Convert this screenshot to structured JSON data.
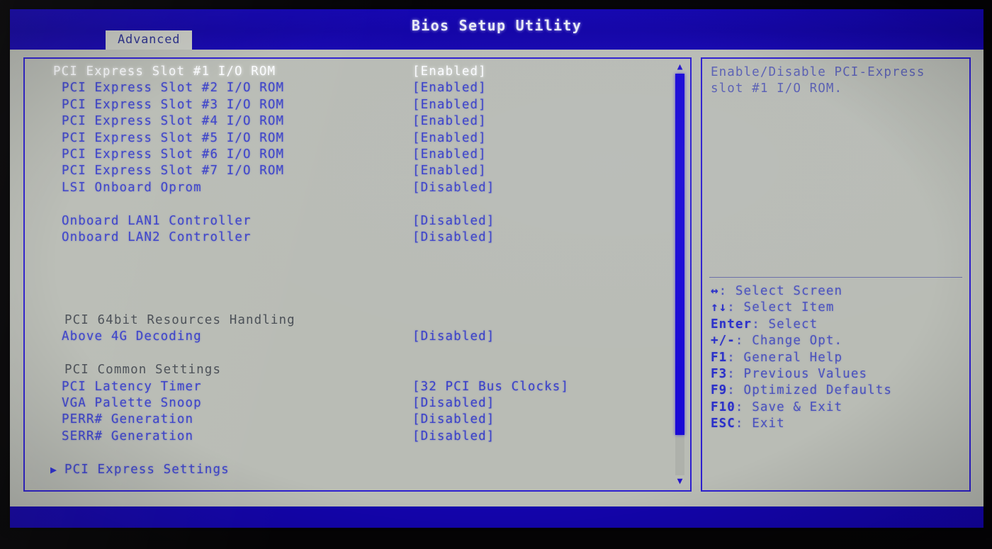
{
  "window": {
    "title": "Bios Setup Utility"
  },
  "tabs": [
    {
      "label": "Advanced",
      "active": true
    }
  ],
  "colors": {
    "header_blue": "#1203a6",
    "panel_gray": "#b9bcb5",
    "item_blue": "#3b41c9",
    "selected_white": "#fbfcff",
    "heading_gray": "#4a4f56",
    "border_blue": "#2d1fd0",
    "scrollbar_thumb": "#1a09d6"
  },
  "settings": [
    {
      "label": "PCI Express Slot #1 I/O ROM",
      "value": "[Enabled]",
      "type": "option",
      "selected": true
    },
    {
      "label": "PCI Express Slot #2 I/O ROM",
      "value": "[Enabled]",
      "type": "option",
      "selected": false
    },
    {
      "label": "PCI Express Slot #3 I/O ROM",
      "value": "[Enabled]",
      "type": "option",
      "selected": false
    },
    {
      "label": "PCI Express Slot #4 I/O ROM",
      "value": "[Enabled]",
      "type": "option",
      "selected": false
    },
    {
      "label": "PCI Express Slot #5 I/O ROM",
      "value": "[Enabled]",
      "type": "option",
      "selected": false
    },
    {
      "label": "PCI Express Slot #6 I/O ROM",
      "value": "[Enabled]",
      "type": "option",
      "selected": false
    },
    {
      "label": "PCI Express Slot #7 I/O ROM",
      "value": "[Enabled]",
      "type": "option",
      "selected": false
    },
    {
      "label": "LSI Onboard Oprom",
      "value": "[Disabled]",
      "type": "option",
      "selected": false
    },
    {
      "label": "",
      "value": "",
      "type": "spacer",
      "selected": false
    },
    {
      "label": "Onboard LAN1 Controller",
      "value": "[Disabled]",
      "type": "option",
      "selected": false
    },
    {
      "label": "Onboard LAN2 Controller",
      "value": "[Disabled]",
      "type": "option",
      "selected": false
    },
    {
      "label": "",
      "value": "",
      "type": "spacer",
      "selected": false
    },
    {
      "label": "",
      "value": "",
      "type": "spacer",
      "selected": false
    },
    {
      "label": "",
      "value": "",
      "type": "spacer",
      "selected": false
    },
    {
      "label": "",
      "value": "",
      "type": "spacer",
      "selected": false
    },
    {
      "label": "PCI 64bit Resources Handling",
      "value": "",
      "type": "heading",
      "selected": false
    },
    {
      "label": "Above 4G Decoding",
      "value": "[Disabled]",
      "type": "option",
      "selected": false
    },
    {
      "label": "",
      "value": "",
      "type": "spacer",
      "selected": false
    },
    {
      "label": "PCI Common Settings",
      "value": "",
      "type": "heading",
      "selected": false
    },
    {
      "label": "PCI Latency Timer",
      "value": "[32 PCI Bus Clocks]",
      "type": "option",
      "selected": false
    },
    {
      "label": "VGA Palette Snoop",
      "value": "[Disabled]",
      "type": "option",
      "selected": false
    },
    {
      "label": "PERR# Generation",
      "value": "[Disabled]",
      "type": "option",
      "selected": false
    },
    {
      "label": "SERR# Generation",
      "value": "[Disabled]",
      "type": "option",
      "selected": false
    },
    {
      "label": "",
      "value": "",
      "type": "spacer",
      "selected": false
    },
    {
      "label": "PCI Express Settings",
      "value": "",
      "type": "submenu",
      "selected": false
    }
  ],
  "scrollbar": {
    "up_glyph": "▲",
    "down_glyph": "▼",
    "thumb_percent": 90
  },
  "help": {
    "text": "Enable/Disable PCI-Express slot #1 I/O ROM."
  },
  "key_legend": [
    {
      "key": "↔",
      "label": ": Select Screen"
    },
    {
      "key": "↑↓",
      "label": ": Select Item"
    },
    {
      "key": "Enter",
      "label": ": Select"
    },
    {
      "key": "+/-",
      "label": ": Change Opt."
    },
    {
      "key": "F1",
      "label": ": General Help"
    },
    {
      "key": "F3",
      "label": ": Previous Values"
    },
    {
      "key": "F9",
      "label": ": Optimized Defaults"
    },
    {
      "key": "F10",
      "label": ": Save & Exit"
    },
    {
      "key": "ESC",
      "label": ": Exit"
    }
  ],
  "submenu_arrow": "▶"
}
